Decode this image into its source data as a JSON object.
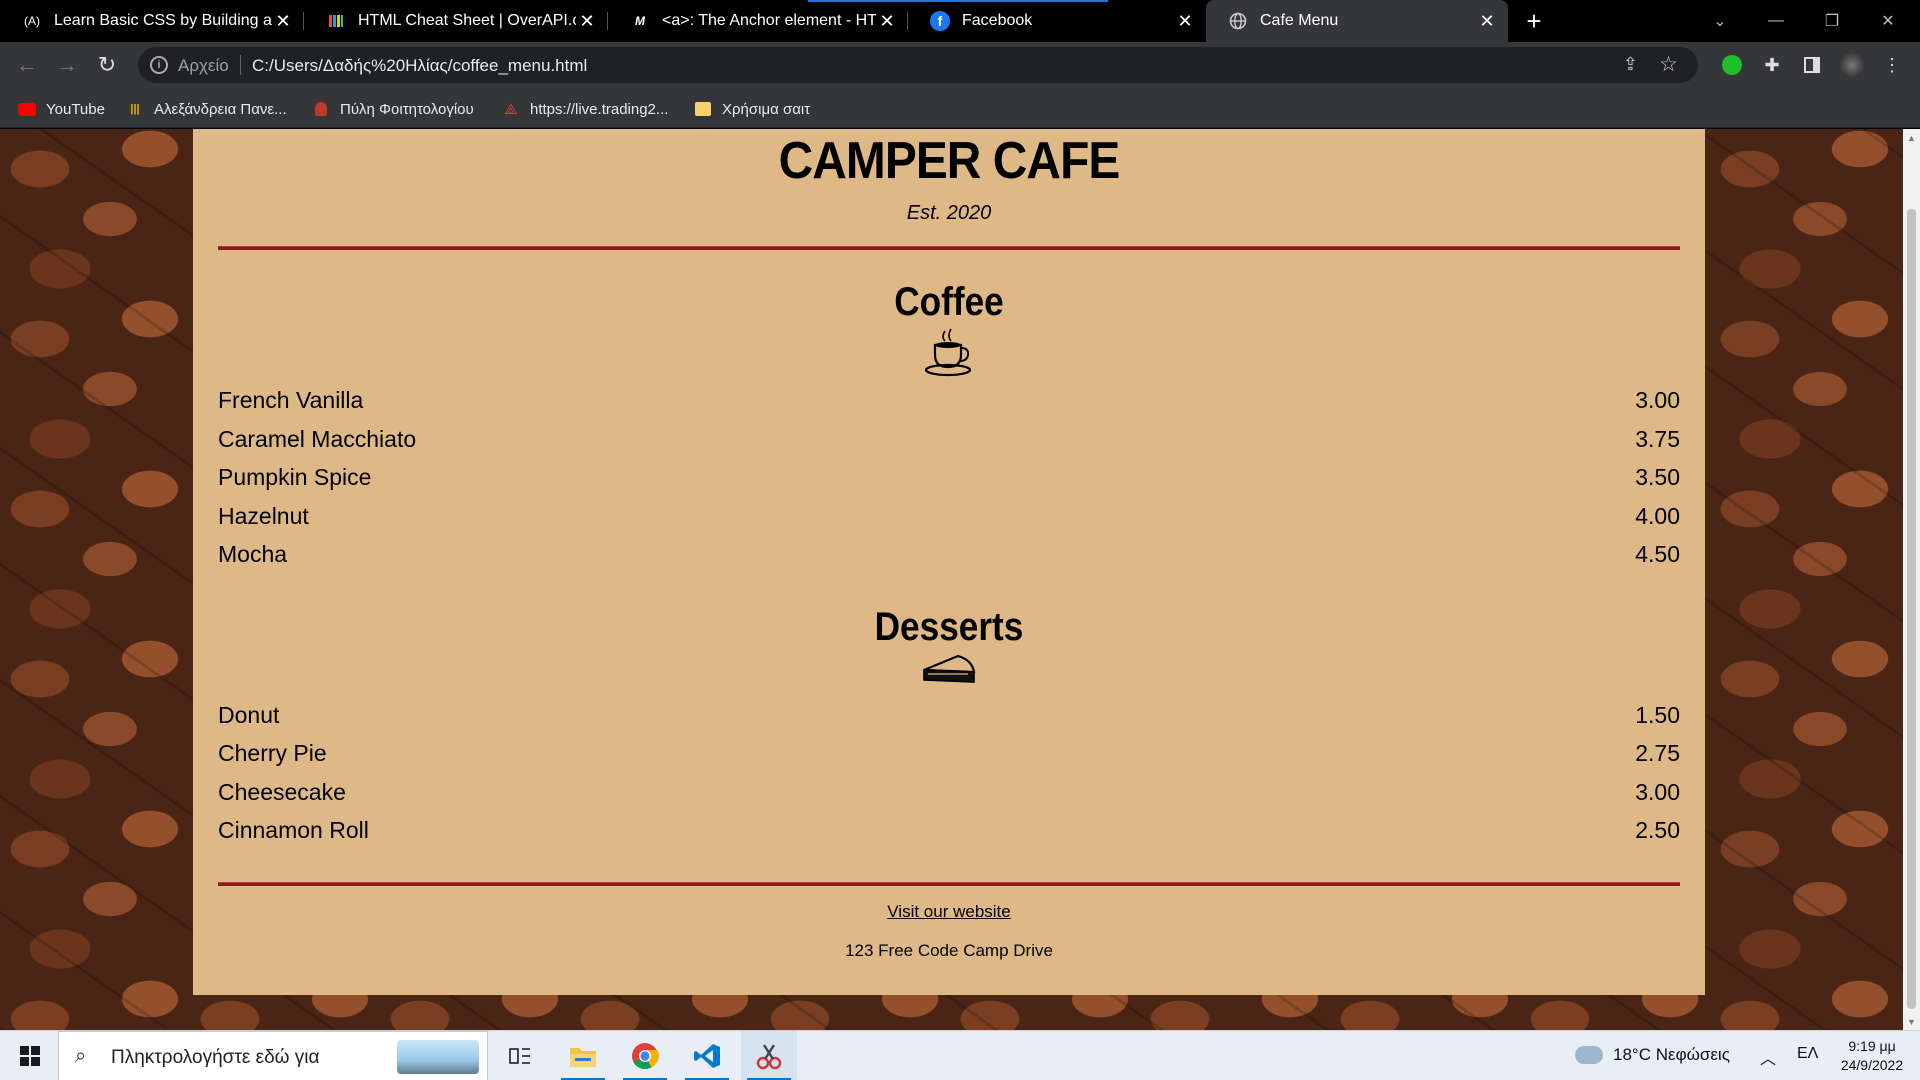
{
  "tabs": [
    {
      "favicon": "(A)",
      "title": "Learn Basic CSS by Building a Cafe",
      "icon_name": "freecodecamp-icon"
    },
    {
      "favicon": "",
      "title": "HTML Cheat Sheet | OverAPI.com",
      "icon_name": "overapi-icon"
    },
    {
      "favicon": "M",
      "title": "<a>: The Anchor element - HTML",
      "icon_name": "mdn-icon"
    },
    {
      "favicon": "f",
      "title": "Facebook",
      "icon_name": "facebook-icon"
    },
    {
      "favicon": "",
      "title": "Cafe Menu",
      "icon_name": "globe-icon"
    }
  ],
  "toolbar": {
    "scheme_label": "Αρχείο",
    "url": "C:/Users/Δαδής%20Ηλίας/coffee_menu.html"
  },
  "bookmarks": [
    {
      "label": "YouTube",
      "icon_name": "youtube-icon",
      "color": "#ff0000"
    },
    {
      "label": "Αλεξάνδρεια Πανε...",
      "icon_name": "library-icon",
      "color": "#f2b600"
    },
    {
      "label": "Πύλη Φοιτητολογίου",
      "icon_name": "university-icon",
      "color": "#c0392b"
    },
    {
      "label": "https://live.trading2...",
      "icon_name": "trading-icon",
      "color": "#e53935"
    },
    {
      "label": "Χρήσιμα σαιτ",
      "icon_name": "folder-icon",
      "color": "#f6d36b"
    }
  ],
  "page": {
    "cafe_name": "CAMPER CAFE",
    "established": "Est. 2020",
    "coffee": {
      "heading": "Coffee",
      "icon_name": "coffee-cup-icon",
      "items": [
        {
          "flavor": "French Vanilla",
          "price": "3.00"
        },
        {
          "flavor": "Caramel Macchiato",
          "price": "3.75"
        },
        {
          "flavor": "Pumpkin Spice",
          "price": "3.50"
        },
        {
          "flavor": "Hazelnut",
          "price": "4.00"
        },
        {
          "flavor": "Mocha",
          "price": "4.50"
        }
      ]
    },
    "desserts": {
      "heading": "Desserts",
      "icon_name": "pie-slice-icon",
      "items": [
        {
          "flavor": "Donut",
          "price": "1.50"
        },
        {
          "flavor": "Cherry Pie",
          "price": "2.75"
        },
        {
          "flavor": "Cheesecake",
          "price": "3.00"
        },
        {
          "flavor": "Cinnamon Roll",
          "price": "2.50"
        }
      ]
    },
    "footer": {
      "link_text": "Visit our website",
      "address": "123 Free Code Camp Drive"
    },
    "colors": {
      "menu_background": "#deb887",
      "divider": "#8b1a1a"
    }
  },
  "taskbar": {
    "search_placeholder": "Πληκτρολογήστε εδώ για",
    "weather": "18°C  Νεφώσεις",
    "language": "ΕΛ",
    "time": "9:19 μμ",
    "date": "24/9/2022"
  }
}
